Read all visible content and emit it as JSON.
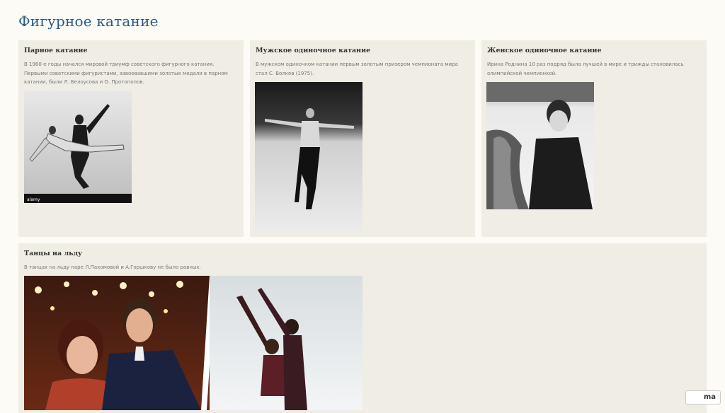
{
  "page": {
    "title": "Фигурное катание"
  },
  "cards": [
    {
      "heading": "Парное катание",
      "text": "В 1960-е годы начался мировой триумф советского фигурного катания. Первыми советскими фигуристами, завоевавшими золотые медали в парном катании, были Л. Белоусова и О. Протопопов.",
      "image_caption": "alamy"
    },
    {
      "heading": "Мужское одиночное катание",
      "text": "В мужском одиночном катании первым золотым призером чемпионата мира стал С. Волков (1975)."
    },
    {
      "heading": "Женское одиночное катание",
      "text": "Ирина Роднина 10 раз подряд была лучшей в мире и трижды становилась олимпийской чемпионкой."
    },
    {
      "heading": "Танцы на льду",
      "text": "В танцах на льду паре Л.Пахомовой и А.Горшкову не было равных."
    }
  ],
  "badge": {
    "label": "ma"
  },
  "colors": {
    "title": "#2a5b86",
    "card_bg": "#efede4",
    "page_bg": "#fdfbf6"
  }
}
